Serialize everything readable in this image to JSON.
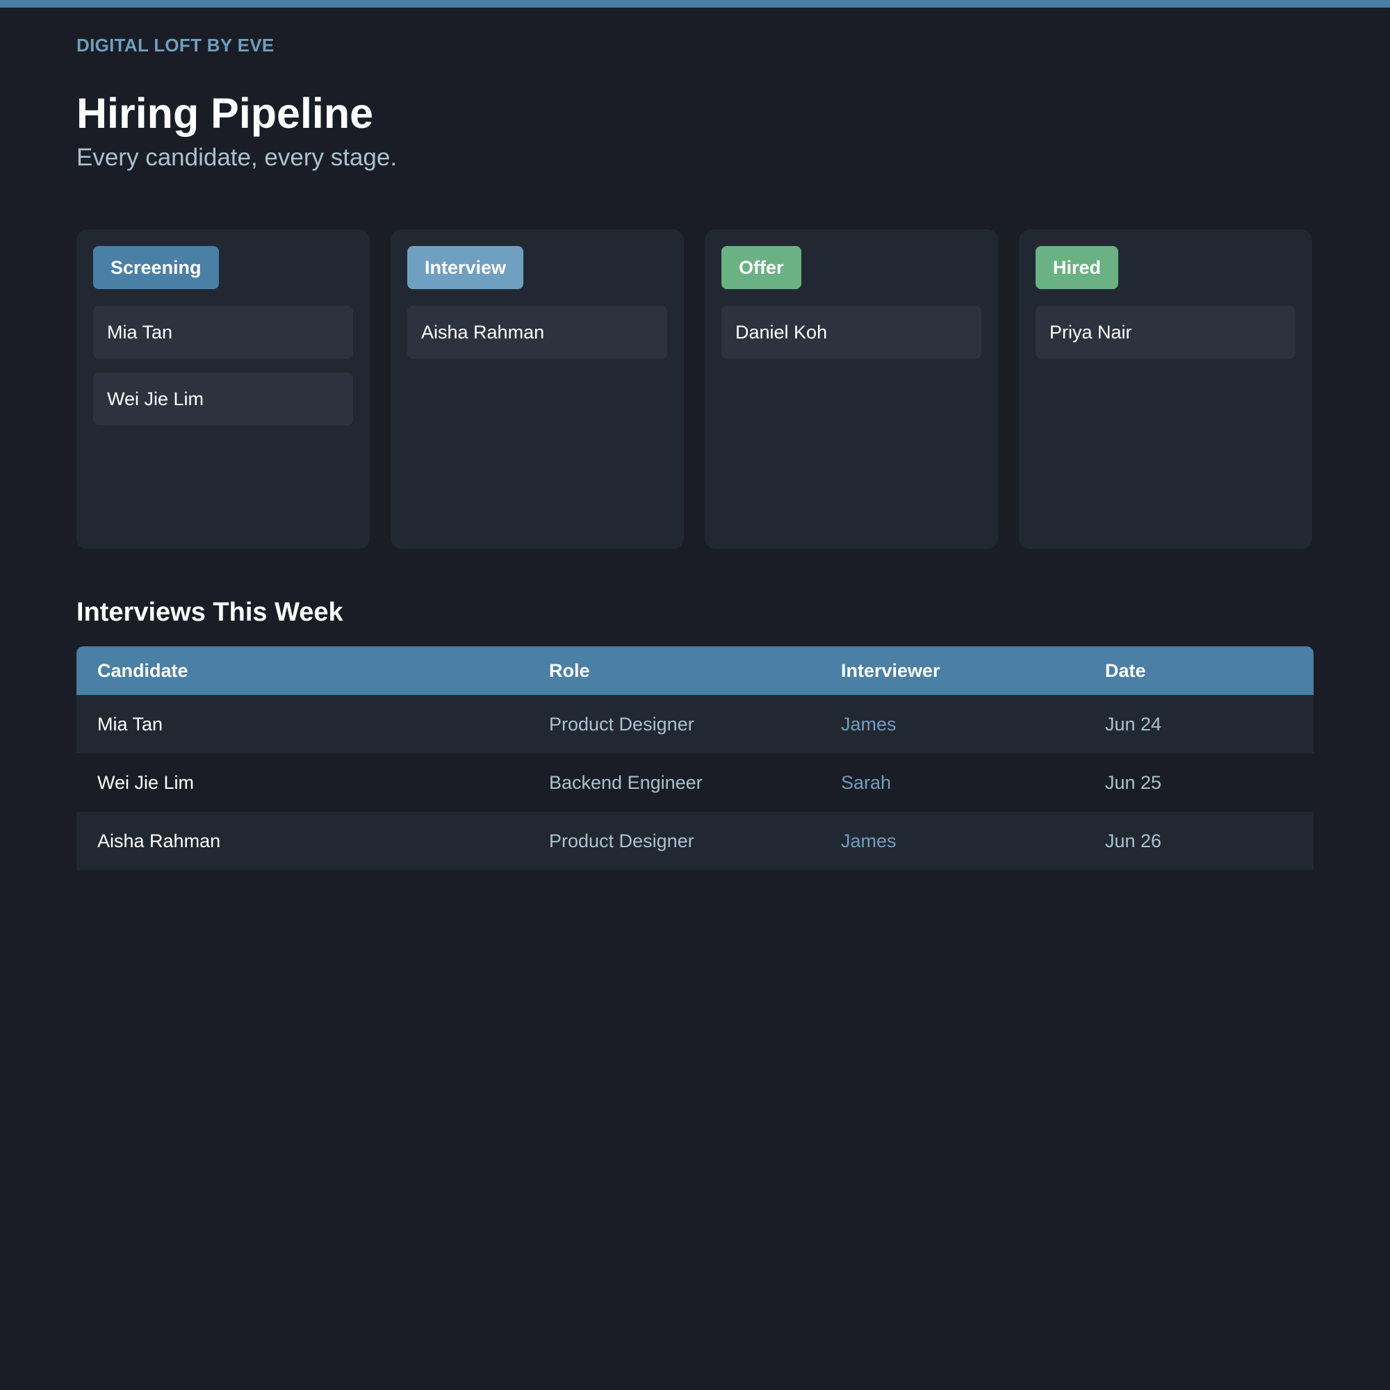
{
  "brand": "DIGITAL LOFT BY EVE",
  "header": {
    "title": "Hiring Pipeline",
    "subtitle": "Every candidate, every stage."
  },
  "pipeline": {
    "columns": [
      {
        "stage": "Screening",
        "color": "#4a7fa6",
        "candidates": [
          "Mia Tan",
          "Wei Jie Lim"
        ]
      },
      {
        "stage": "Interview",
        "color": "#6fa0c2",
        "candidates": [
          "Aisha Rahman"
        ]
      },
      {
        "stage": "Offer",
        "color": "#6ab283",
        "candidates": [
          "Daniel Koh"
        ]
      },
      {
        "stage": "Hired",
        "color": "#6ab283",
        "candidates": [
          "Priya Nair"
        ]
      }
    ]
  },
  "interviews": {
    "title": "Interviews This Week",
    "columns": [
      "Candidate",
      "Role",
      "Interviewer",
      "Date"
    ],
    "rows": [
      {
        "candidate": "Mia Tan",
        "role": "Product Designer",
        "interviewer": "James",
        "date": "Jun 24"
      },
      {
        "candidate": "Wei Jie Lim",
        "role": "Backend Engineer",
        "interviewer": "Sarah",
        "date": "Jun 25"
      },
      {
        "candidate": "Aisha Rahman",
        "role": "Product Designer",
        "interviewer": "James",
        "date": "Jun 26"
      }
    ]
  },
  "colors": {
    "accent": "#4a7fa6",
    "background": "#1a1d25",
    "panel": "#222831",
    "card": "#2c333e",
    "muted_text": "#a9c2cf",
    "link_text": "#6f9fbf"
  }
}
